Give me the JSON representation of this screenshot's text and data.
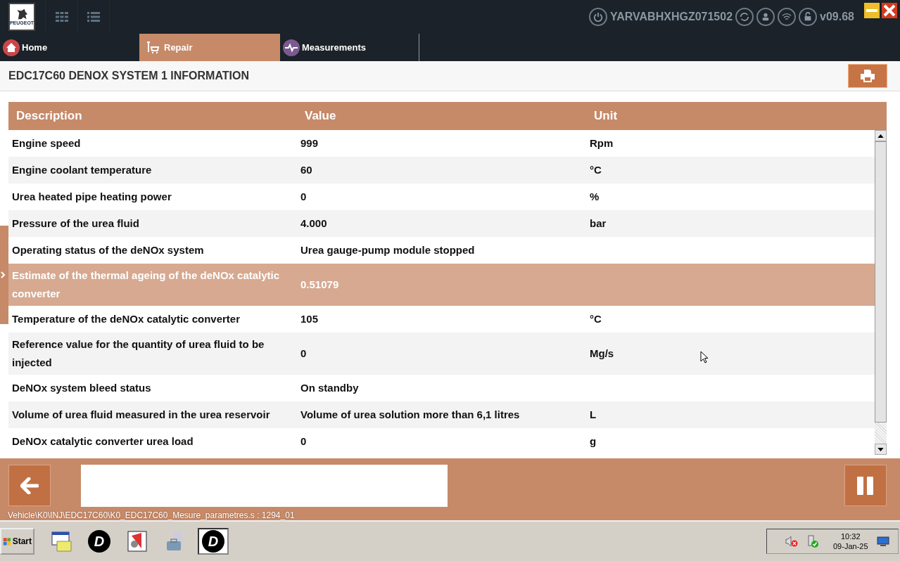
{
  "top_bar": {
    "logo_text": "PEUGEOT",
    "vin": "YARVABHXHGZ071502",
    "version": "v09.68"
  },
  "tabs": [
    {
      "label": "Home",
      "kind": "home",
      "selected": false
    },
    {
      "label": "Repair",
      "kind": "repair",
      "selected": true
    },
    {
      "label": "Measurements",
      "kind": "measure",
      "selected": false
    }
  ],
  "page_title": "EDC17C60 DENOX SYSTEM 1 INFORMATION",
  "table": {
    "columns": [
      "Description",
      "Value",
      "Unit"
    ],
    "rows": [
      {
        "description": "Engine speed",
        "value": "999",
        "unit": "Rpm",
        "selected": false
      },
      {
        "description": "Engine coolant temperature",
        "value": "60",
        "unit": "°C",
        "selected": false
      },
      {
        "description": "Urea heated pipe heating power",
        "value": "0",
        "unit": "%",
        "selected": false
      },
      {
        "description": "Pressure of the urea fluid",
        "value": "4.000",
        "unit": "bar",
        "selected": false
      },
      {
        "description": "Operating status of the deNOx system",
        "value": "Urea gauge-pump module stopped",
        "selected": false
      },
      {
        "description": "Estimate of the thermal ageing of the deNOx catalytic converter",
        "value": "0.51079",
        "selected": true
      },
      {
        "description": "Temperature of the deNOx catalytic converter",
        "value": "105",
        "unit": "°C",
        "selected": false
      },
      {
        "description": "Reference value for the quantity of urea fluid to be injected",
        "value": "0",
        "unit": "Mg/s",
        "selected": false
      },
      {
        "description": "DeNOx system bleed status",
        "value": "On standby",
        "selected": false
      },
      {
        "description": "Volume of urea fluid measured in the urea reservoir",
        "value": "Volume of urea solution more than 6,1 litres",
        "unit": "L",
        "selected": false
      },
      {
        "description": "DeNOx catalytic converter urea load",
        "value": "0",
        "unit": "g",
        "selected": false
      }
    ]
  },
  "status_path": "Vehicle\\K0\\INJ\\EDC17C60\\K0_EDC17C60_Mesure_parametres.s : 1294_01",
  "taskbar": {
    "start": "Start",
    "apps": [
      {
        "kind": "folder",
        "active": false
      },
      {
        "kind": "d",
        "label": "D",
        "active": false
      },
      {
        "kind": "doc",
        "active": false
      },
      {
        "kind": "toolbox",
        "active": false
      },
      {
        "kind": "d",
        "label": "D",
        "active": true
      }
    ],
    "time": "10:32",
    "date": "09-Jan-25"
  }
}
